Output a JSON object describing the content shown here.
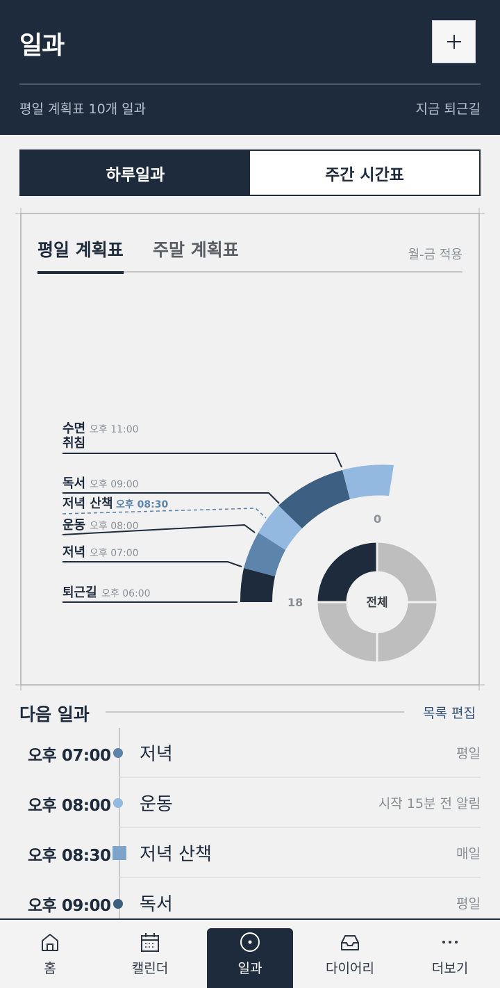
{
  "header": {
    "title": "일과",
    "subtitle_left": "평일 계획표 10개 일과",
    "subtitle_right": "지금 퇴근길"
  },
  "segmented": {
    "daily": "하루일과",
    "weekly": "주간 시간표"
  },
  "tabs": {
    "weekday": "평일 계획표",
    "weekend": "주말 계획표",
    "apply_note": "월-금 적용"
  },
  "chart_data": {
    "type": "donut",
    "arc_label_start": "0",
    "arc_label_end": "18",
    "center_label": "전체",
    "legend": [
      {
        "name": "수면",
        "time": "오후 11:00",
        "extra": "취침",
        "color": "#93b9e0"
      },
      {
        "name": "독서",
        "time": "오후 09:00",
        "color": "#3d5f82"
      },
      {
        "name": "저녁 산책",
        "time": "오후 08:30",
        "color": "#93b9e0",
        "highlight": true
      },
      {
        "name": "운동",
        "time": "오후 08:00",
        "color": "#5d84ab"
      },
      {
        "name": "저녁",
        "time": "오후 07:00",
        "color": "#5d84ab"
      },
      {
        "name": "퇴근길",
        "time": "오후 06:00",
        "color": "#1e2b3c"
      }
    ],
    "progress_quadrants": {
      "completed": 1,
      "total": 4
    }
  },
  "next": {
    "title": "다음 일과",
    "edit_label": "목록 편집",
    "items": [
      {
        "time": "오후 07:00",
        "name": "저녁",
        "meta": "평일",
        "marker": "dot",
        "color": "#5d84ab"
      },
      {
        "time": "오후 08:00",
        "name": "운동",
        "meta": "시작 15분 전 알림",
        "marker": "dot",
        "color": "#93b9e0"
      },
      {
        "time": "오후 08:30",
        "name": "저녁 산책",
        "meta": "매일",
        "marker": "square",
        "color": "#7da3c9"
      },
      {
        "time": "오후 09:00",
        "name": "독서",
        "meta": "평일",
        "marker": "dot",
        "color": "#3d5f82"
      }
    ]
  },
  "nav": {
    "home": "홈",
    "calendar": "캘린더",
    "routine": "일과",
    "diary": "다이어리",
    "more": "더보기"
  }
}
